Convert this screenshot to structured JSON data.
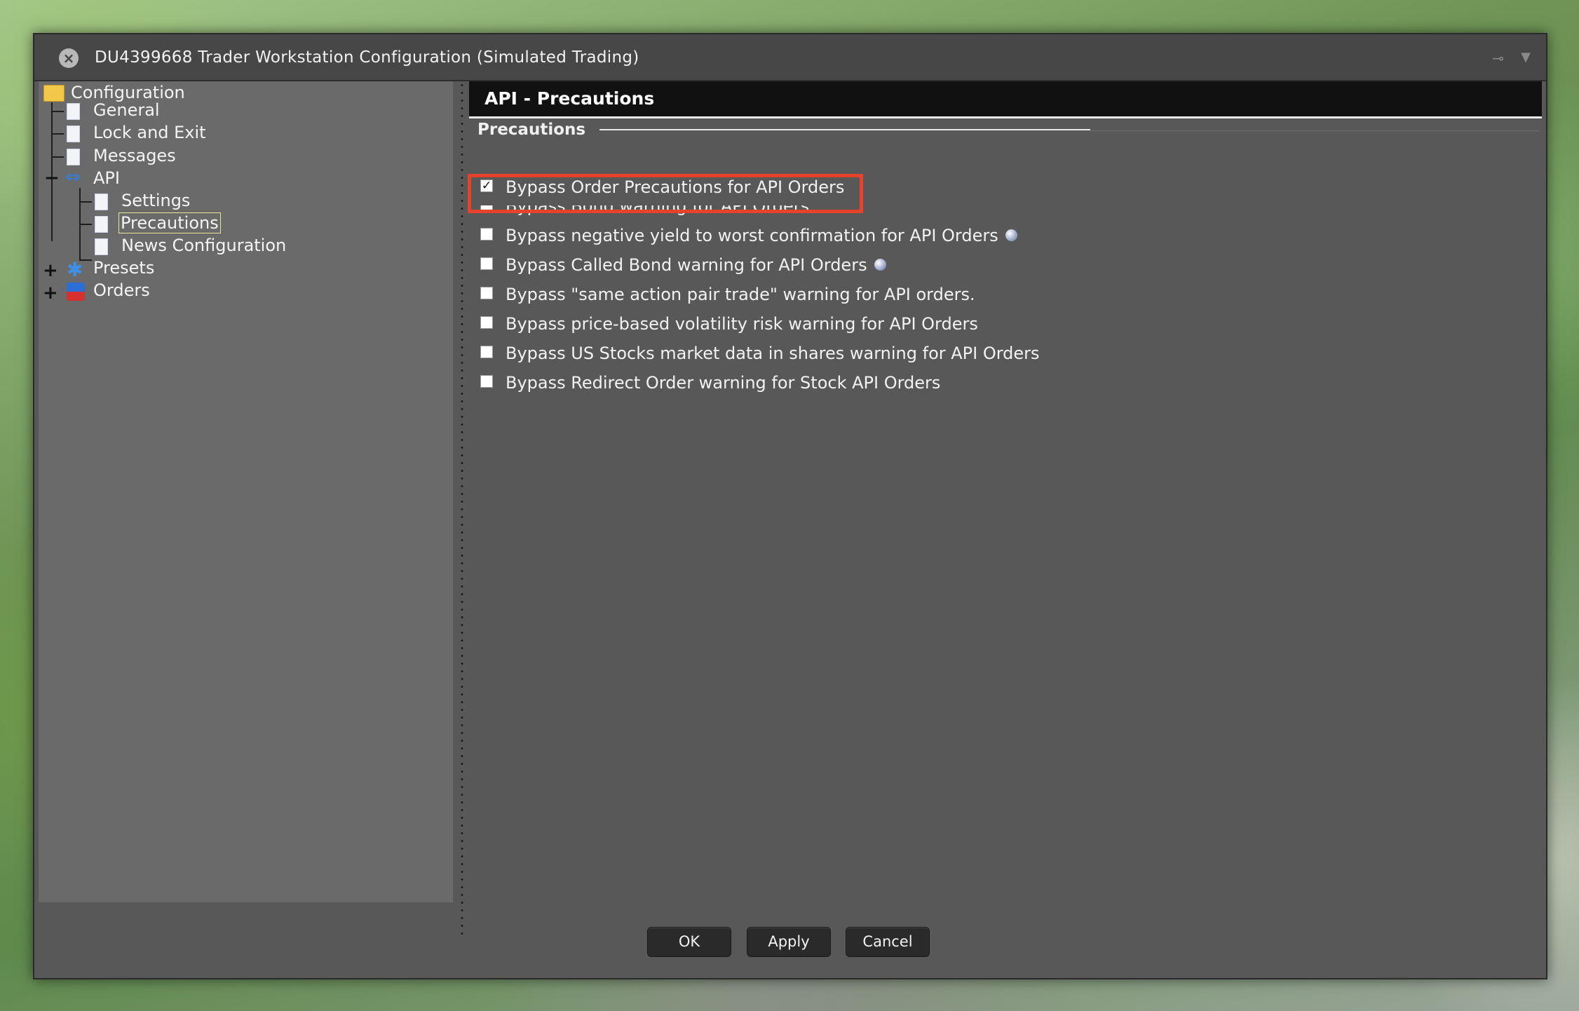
{
  "window": {
    "title": "DU4399668 Trader Workstation Configuration (Simulated Trading)",
    "icons": [
      "close-icon",
      "pin-icon",
      "menu-icon"
    ]
  },
  "tree": {
    "root": "Configuration",
    "general": "General",
    "lock_exit": "Lock and Exit",
    "messages": "Messages",
    "api": "API",
    "settings": "Settings",
    "precautions": "Precautions",
    "news_config": "News Configuration",
    "presets": "Presets",
    "orders": "Orders"
  },
  "panel": {
    "header": "API - Precautions",
    "section": "Precautions",
    "options": [
      {
        "label": "Bypass Order Precautions for API Orders",
        "checked": true,
        "info": false
      },
      {
        "label": "Bypass Bond warning for API Orders",
        "checked": false,
        "info": false
      },
      {
        "label": "Bypass negative yield to worst confirmation for API Orders",
        "checked": false,
        "info": true
      },
      {
        "label": "Bypass Called Bond warning for API Orders",
        "checked": false,
        "info": true
      },
      {
        "label": "Bypass \"same action pair trade\" warning for API orders.",
        "checked": false,
        "info": false
      },
      {
        "label": "Bypass price-based volatility risk warning for API Orders",
        "checked": false,
        "info": false
      },
      {
        "label": "Bypass US Stocks market data in shares warning for API Orders",
        "checked": false,
        "info": false
      },
      {
        "label": "Bypass Redirect Order warning for Stock API Orders",
        "checked": false,
        "info": false
      }
    ]
  },
  "buttons": {
    "ok": "OK",
    "apply": "Apply",
    "cancel": "Cancel"
  },
  "colors": {
    "highlight": "#e8412c",
    "header_bg": "#111111",
    "window_bg": "#585858"
  }
}
